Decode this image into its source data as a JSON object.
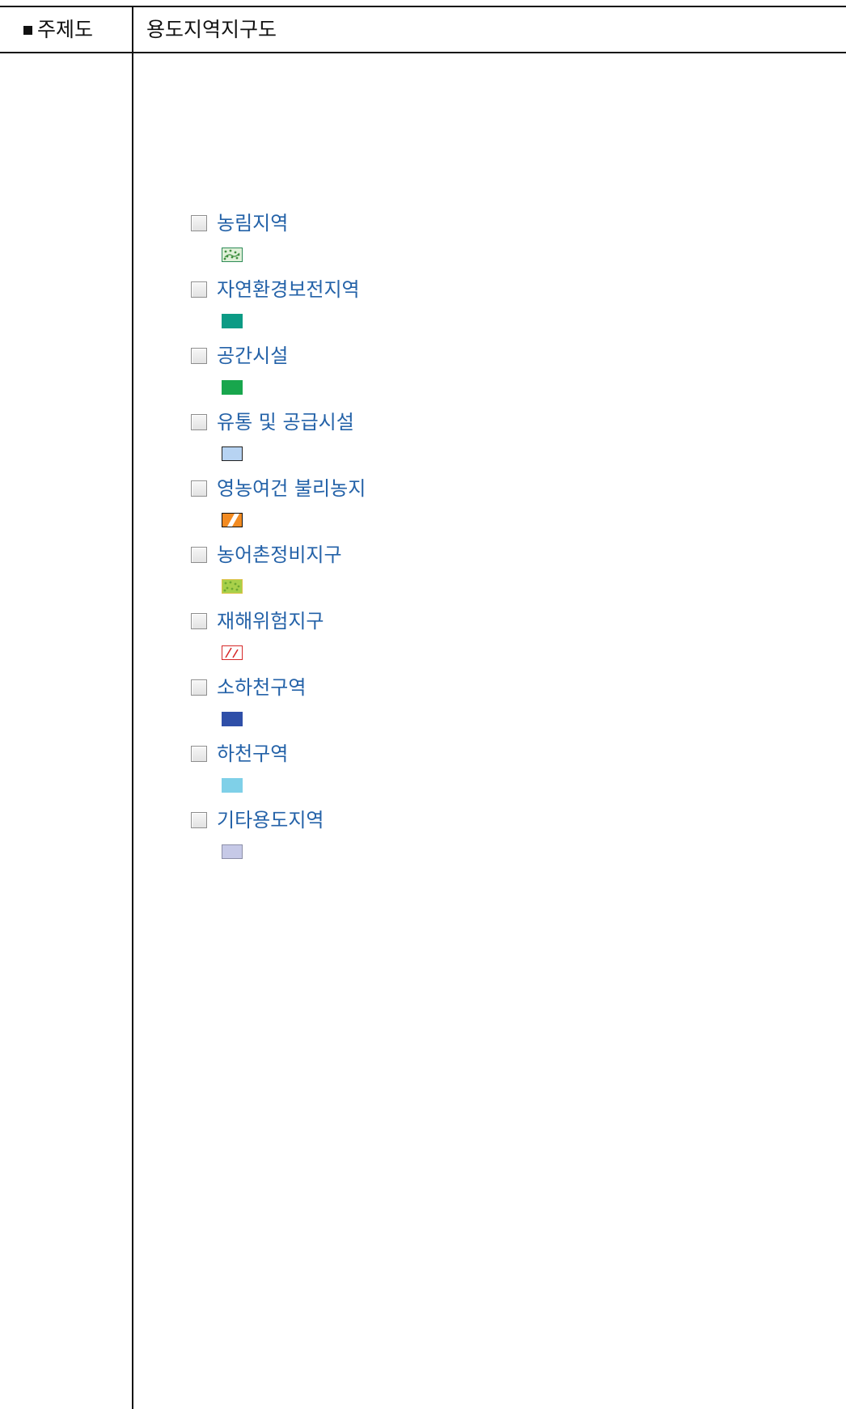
{
  "header": {
    "label": "주제도",
    "value": "용도지역지구도"
  },
  "legend": {
    "items": [
      {
        "label": "농림지역",
        "checked": false,
        "swatch": {
          "pattern": "dotted-hatch",
          "fill": "#dff0d8",
          "stroke": "#2e8b57",
          "accent": "#3f8f3f"
        }
      },
      {
        "label": "자연환경보전지역",
        "checked": false,
        "swatch": {
          "pattern": "solid",
          "fill": "#0c9b85",
          "stroke": "#0c9b85"
        }
      },
      {
        "label": "공간시설",
        "checked": false,
        "swatch": {
          "pattern": "solid",
          "fill": "#18a64d",
          "stroke": "#18a64d"
        }
      },
      {
        "label": "유통 및 공급시설",
        "checked": false,
        "swatch": {
          "pattern": "solid",
          "fill": "#b7d3f2",
          "stroke": "#222222"
        }
      },
      {
        "label": "영농여건 불리농지",
        "checked": false,
        "swatch": {
          "pattern": "diagonal-stripe",
          "fill": "#f28b22",
          "stroke": "#111111",
          "accent": "#ffffff"
        }
      },
      {
        "label": "농어촌정비지구",
        "checked": false,
        "swatch": {
          "pattern": "dotted",
          "fill": "#a8d04a",
          "stroke": "#e0c24a",
          "accent": "#6ea832"
        }
      },
      {
        "label": "재해위험지구",
        "checked": false,
        "swatch": {
          "pattern": "diagonal-line",
          "fill": "#ffffff",
          "stroke": "#d62828",
          "accent": "#d62828"
        }
      },
      {
        "label": "소하천구역",
        "checked": false,
        "swatch": {
          "pattern": "solid",
          "fill": "#2f4fa8",
          "stroke": "#2f4fa8"
        }
      },
      {
        "label": "하천구역",
        "checked": false,
        "swatch": {
          "pattern": "solid",
          "fill": "#7fd0e8",
          "stroke": "#7fd0e8"
        }
      },
      {
        "label": "기타용도지역",
        "checked": false,
        "swatch": {
          "pattern": "solid",
          "fill": "#c6c9e7",
          "stroke": "#8c8fa8"
        }
      }
    ]
  }
}
